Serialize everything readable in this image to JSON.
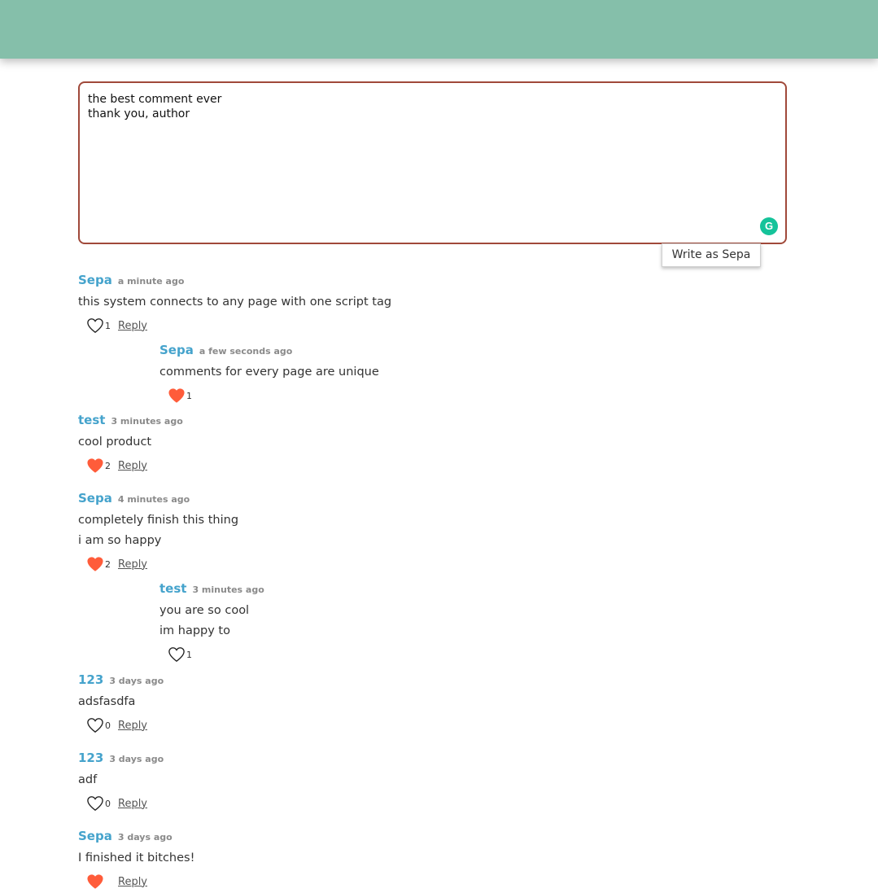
{
  "editor": {
    "value": "the best comment ever\nthank you, author"
  },
  "write_as_label": "Write as Sepa",
  "comments": [
    {
      "author": "Sepa",
      "time": "a minute ago",
      "lines": [
        "this system connects to any page with one script tag"
      ],
      "likes": "1",
      "liked": false,
      "reply_label": "Reply"
    },
    {
      "author": "Sepa",
      "time": "a few seconds ago",
      "lines": [
        "comments for every page are unique"
      ],
      "likes": "1",
      "liked": true
    },
    {
      "author": "test",
      "time": "3 minutes ago",
      "lines": [
        "cool product"
      ],
      "likes": "2",
      "liked": true,
      "reply_label": "Reply"
    },
    {
      "author": "Sepa",
      "time": "4 minutes ago",
      "lines": [
        "completely finish this thing",
        "i am so happy"
      ],
      "likes": "2",
      "liked": true,
      "reply_label": "Reply"
    },
    {
      "author": "test",
      "time": "3 minutes ago",
      "lines": [
        "you are so cool",
        "im happy to"
      ],
      "likes": "1",
      "liked": false
    },
    {
      "author": "123",
      "time": "3 days ago",
      "lines": [
        "adsfasdfa"
      ],
      "likes": "0",
      "liked": false,
      "reply_label": "Reply"
    },
    {
      "author": "123",
      "time": "3 days ago",
      "lines": [
        "adf"
      ],
      "likes": "0",
      "liked": false,
      "reply_label": "Reply"
    },
    {
      "author": "Sepa",
      "time": "3 days ago",
      "lines": [
        "I finished it bitches!"
      ],
      "likes": "",
      "liked": true,
      "reply_label": "Reply"
    }
  ],
  "colors": {
    "header": "#85bfaa",
    "editor_border": "#a0493a",
    "author": "#45a3cc",
    "heart_filled": "#ff5c3a",
    "grammarly": "#15c39a"
  }
}
